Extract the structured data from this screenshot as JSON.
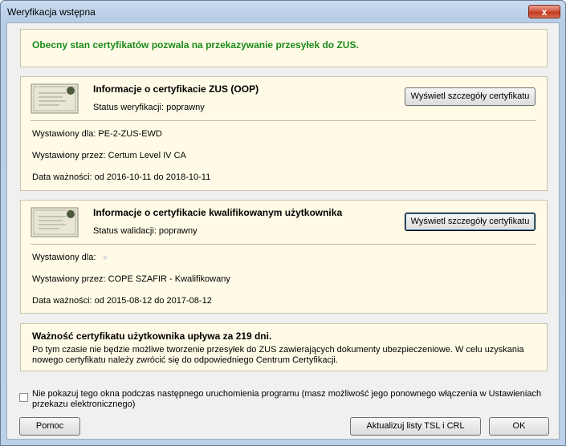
{
  "window": {
    "title": "Weryfikacja wstępna",
    "close_label": "x"
  },
  "status_message": "Obecny stan certyfikatów pozwala na przekazywanie przesyłek do ZUS.",
  "zus_cert": {
    "heading": "Informacje o certyfikacie ZUS (OOP)",
    "verification": "Status weryfikacji: poprawny",
    "button_label": "Wyświetl szczegóły certyfikatu",
    "issued_for": "Wystawiony dla: PE-2-ZUS-EWD",
    "issued_by": "Wystawiony przez: Certum Level IV CA",
    "validity": "Data ważności: od 2016-10-11 do 2018-10-11"
  },
  "user_cert": {
    "heading": "Informacje o certyfikacie kwalifikowanym użytkownika",
    "validation": "Status walidacji: poprawny",
    "button_label": "Wyświetl szczegóły certyfikatu",
    "issued_for": "Wystawiony dla:",
    "issued_by": "Wystawiony przez: COPE SZAFIR - Kwalifikowany",
    "validity": "Data ważności: od 2015-08-12 do 2017-08-12"
  },
  "expiry_warning": {
    "title": "Ważność certyfikatu użytkownika upływa za 219 dni.",
    "text": "Po tym czasie nie będzie możliwe tworzenie przesyłek do ZUS zawierających dokumenty ubezpieczeniowe. W celu uzyskania nowego certyfikatu należy zwrócić się do odpowiedniego Centrum Certyfikacji."
  },
  "dont_show": {
    "checked": false,
    "label": "Nie pokazuj tego okna podczas następnego uruchomienia programu (masz możliwość jego ponownego włączenia w Ustawieniach przekazu elektronicznego)"
  },
  "buttons": {
    "help": "Pomoc",
    "update": "Aktualizuj listy TSL i CRL",
    "ok": "OK"
  }
}
